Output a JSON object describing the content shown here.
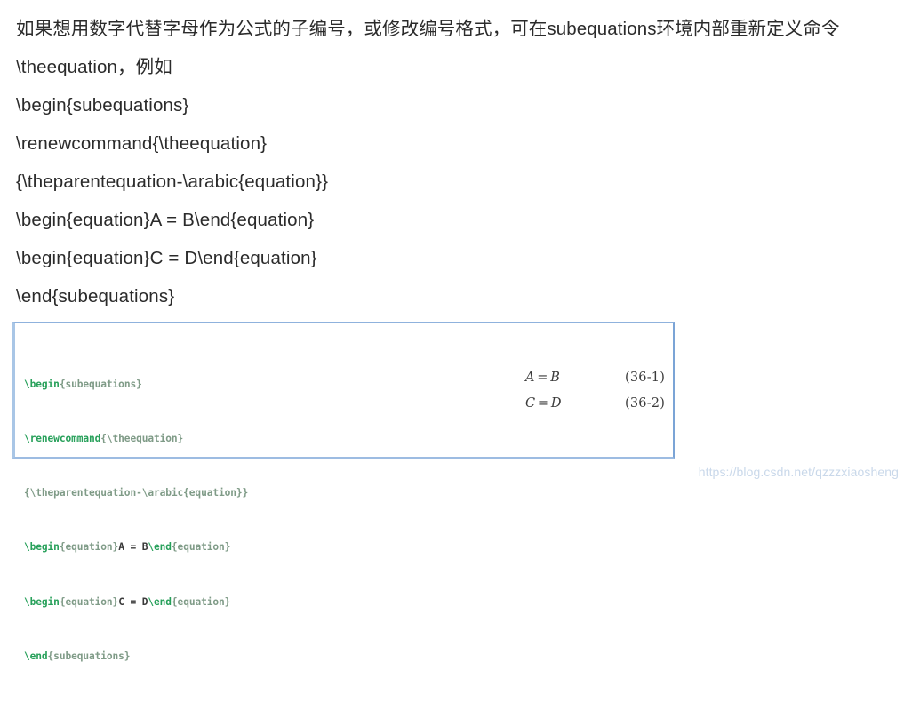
{
  "article": {
    "paragraphs": [
      "如果想用数字代替字母作为公式的子编号，或修改编号格式，可在subequations环境内部重新定义命令\\theequation，例如"
    ],
    "code_lines": [
      "\\begin{subequations}",
      "\\renewcommand{\\theequation}",
      "{\\theparentequation-\\arabic{equation}}",
      "\\begin{equation}A = B\\end{equation}",
      "\\begin{equation}C = D\\end{equation}",
      "\\end{subequations}"
    ]
  },
  "figure": {
    "source_lines": [
      {
        "cmd": "\\begin",
        "arg": "{subequations}",
        "plain": "",
        "cmd2": "",
        "arg2": ""
      },
      {
        "cmd": "\\renewcommand",
        "arg": "{\\theequation}",
        "plain": "",
        "cmd2": "",
        "arg2": ""
      },
      {
        "cmd": "",
        "arg": "{\\theparentequation-\\arabic{equation}}",
        "plain": "",
        "cmd2": "",
        "arg2": ""
      },
      {
        "cmd": "\\begin",
        "arg": "{equation}",
        "plain": "A = B",
        "cmd2": "\\end",
        "arg2": "{equation}"
      },
      {
        "cmd": "\\begin",
        "arg": "{equation}",
        "plain": "C = D",
        "cmd2": "\\end",
        "arg2": "{equation}"
      },
      {
        "cmd": "\\end",
        "arg": "{subequations}",
        "plain": "",
        "cmd2": "",
        "arg2": ""
      }
    ],
    "output": [
      {
        "lhs": "A",
        "op": "=",
        "rhs": "B",
        "number": "(36-1)"
      },
      {
        "lhs": "C",
        "op": "=",
        "rhs": "D",
        "number": "(36-2)"
      }
    ],
    "colors": {
      "command_green": "#27a05a",
      "argument_green": "#7f9b87",
      "plain_text": "#3a3a3a",
      "border_blue": "#8fb2dd"
    }
  },
  "watermark": {
    "text": "https://blog.csdn.net/qzzzxiaosheng",
    "color": "#c9d8ea"
  }
}
